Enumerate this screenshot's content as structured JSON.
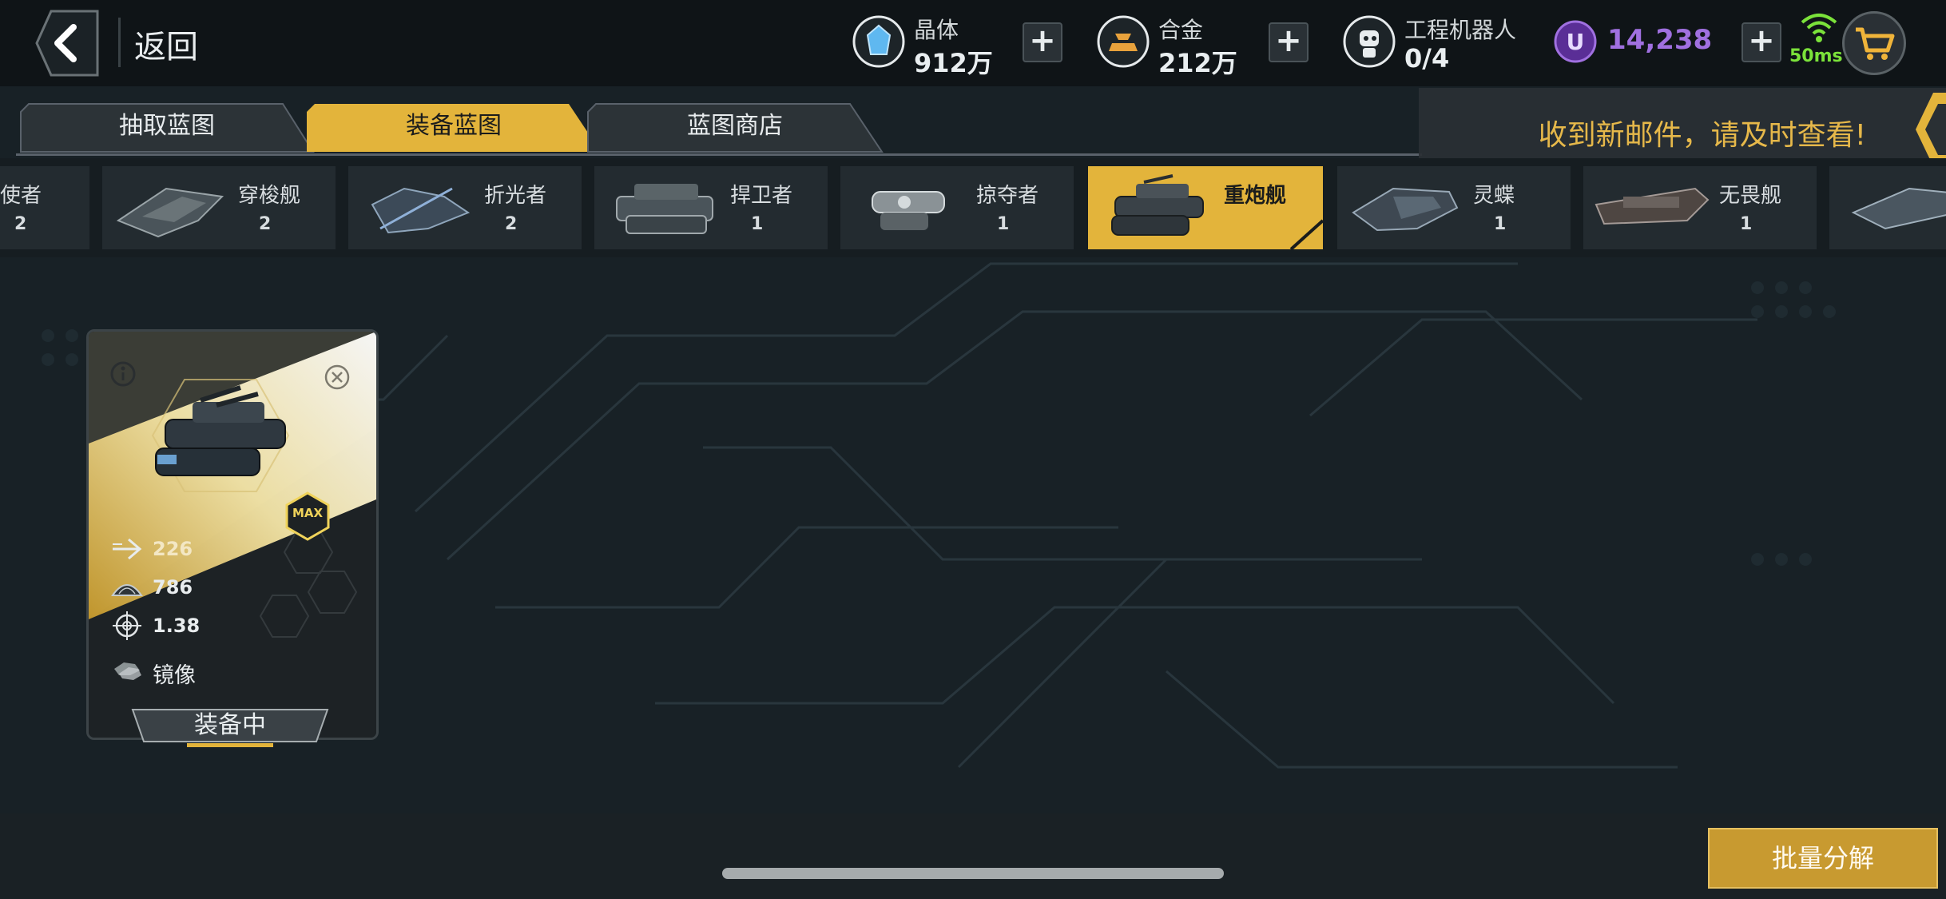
{
  "header": {
    "back_label": "返回",
    "resources": [
      {
        "name": "晶体",
        "value": "912万",
        "icon": "crystal-icon",
        "color": "#5fb8f0"
      },
      {
        "name": "合金",
        "value": "212万",
        "icon": "alloy-icon",
        "color": "#e8a23c"
      },
      {
        "name": "工程机器人",
        "value": "0/4",
        "icon": "robot-icon",
        "color": "#e8ecee"
      }
    ],
    "u_currency": {
      "symbol": "U",
      "amount": "14,238",
      "color": "#a070e0"
    },
    "plus_label": "+",
    "ping": "50ms",
    "ping_color": "#7be23a"
  },
  "tabs": [
    {
      "label": "抽取蓝图",
      "active": false
    },
    {
      "label": "装备蓝图",
      "active": true
    },
    {
      "label": "蓝图商店",
      "active": false
    }
  ],
  "notice": {
    "text": "收到新邮件，请及时查看!"
  },
  "ships": [
    {
      "name": "使者",
      "count": "2"
    },
    {
      "name": "穿梭舰",
      "count": "2"
    },
    {
      "name": "折光者",
      "count": "2"
    },
    {
      "name": "捍卫者",
      "count": "1"
    },
    {
      "name": "掠夺者",
      "count": "1"
    },
    {
      "name": "重炮舰",
      "count": "",
      "selected": true
    },
    {
      "name": "灵蝶",
      "count": "1"
    },
    {
      "name": "无畏舰",
      "count": "1"
    },
    {
      "name": "",
      "count": ""
    }
  ],
  "card": {
    "badge": "MAX",
    "stats": [
      {
        "icon": "speed-arrow-icon",
        "value": "226"
      },
      {
        "icon": "armor-dome-icon",
        "value": "786"
      },
      {
        "icon": "crosshair-icon",
        "value": "1.38"
      },
      {
        "icon": "mirror-ability-icon",
        "value": "镜像"
      }
    ],
    "equip_label": "装备中"
  },
  "bulk_decompose_label": "批量分解",
  "colors": {
    "accent": "#e3b43b",
    "background": "#182126"
  }
}
